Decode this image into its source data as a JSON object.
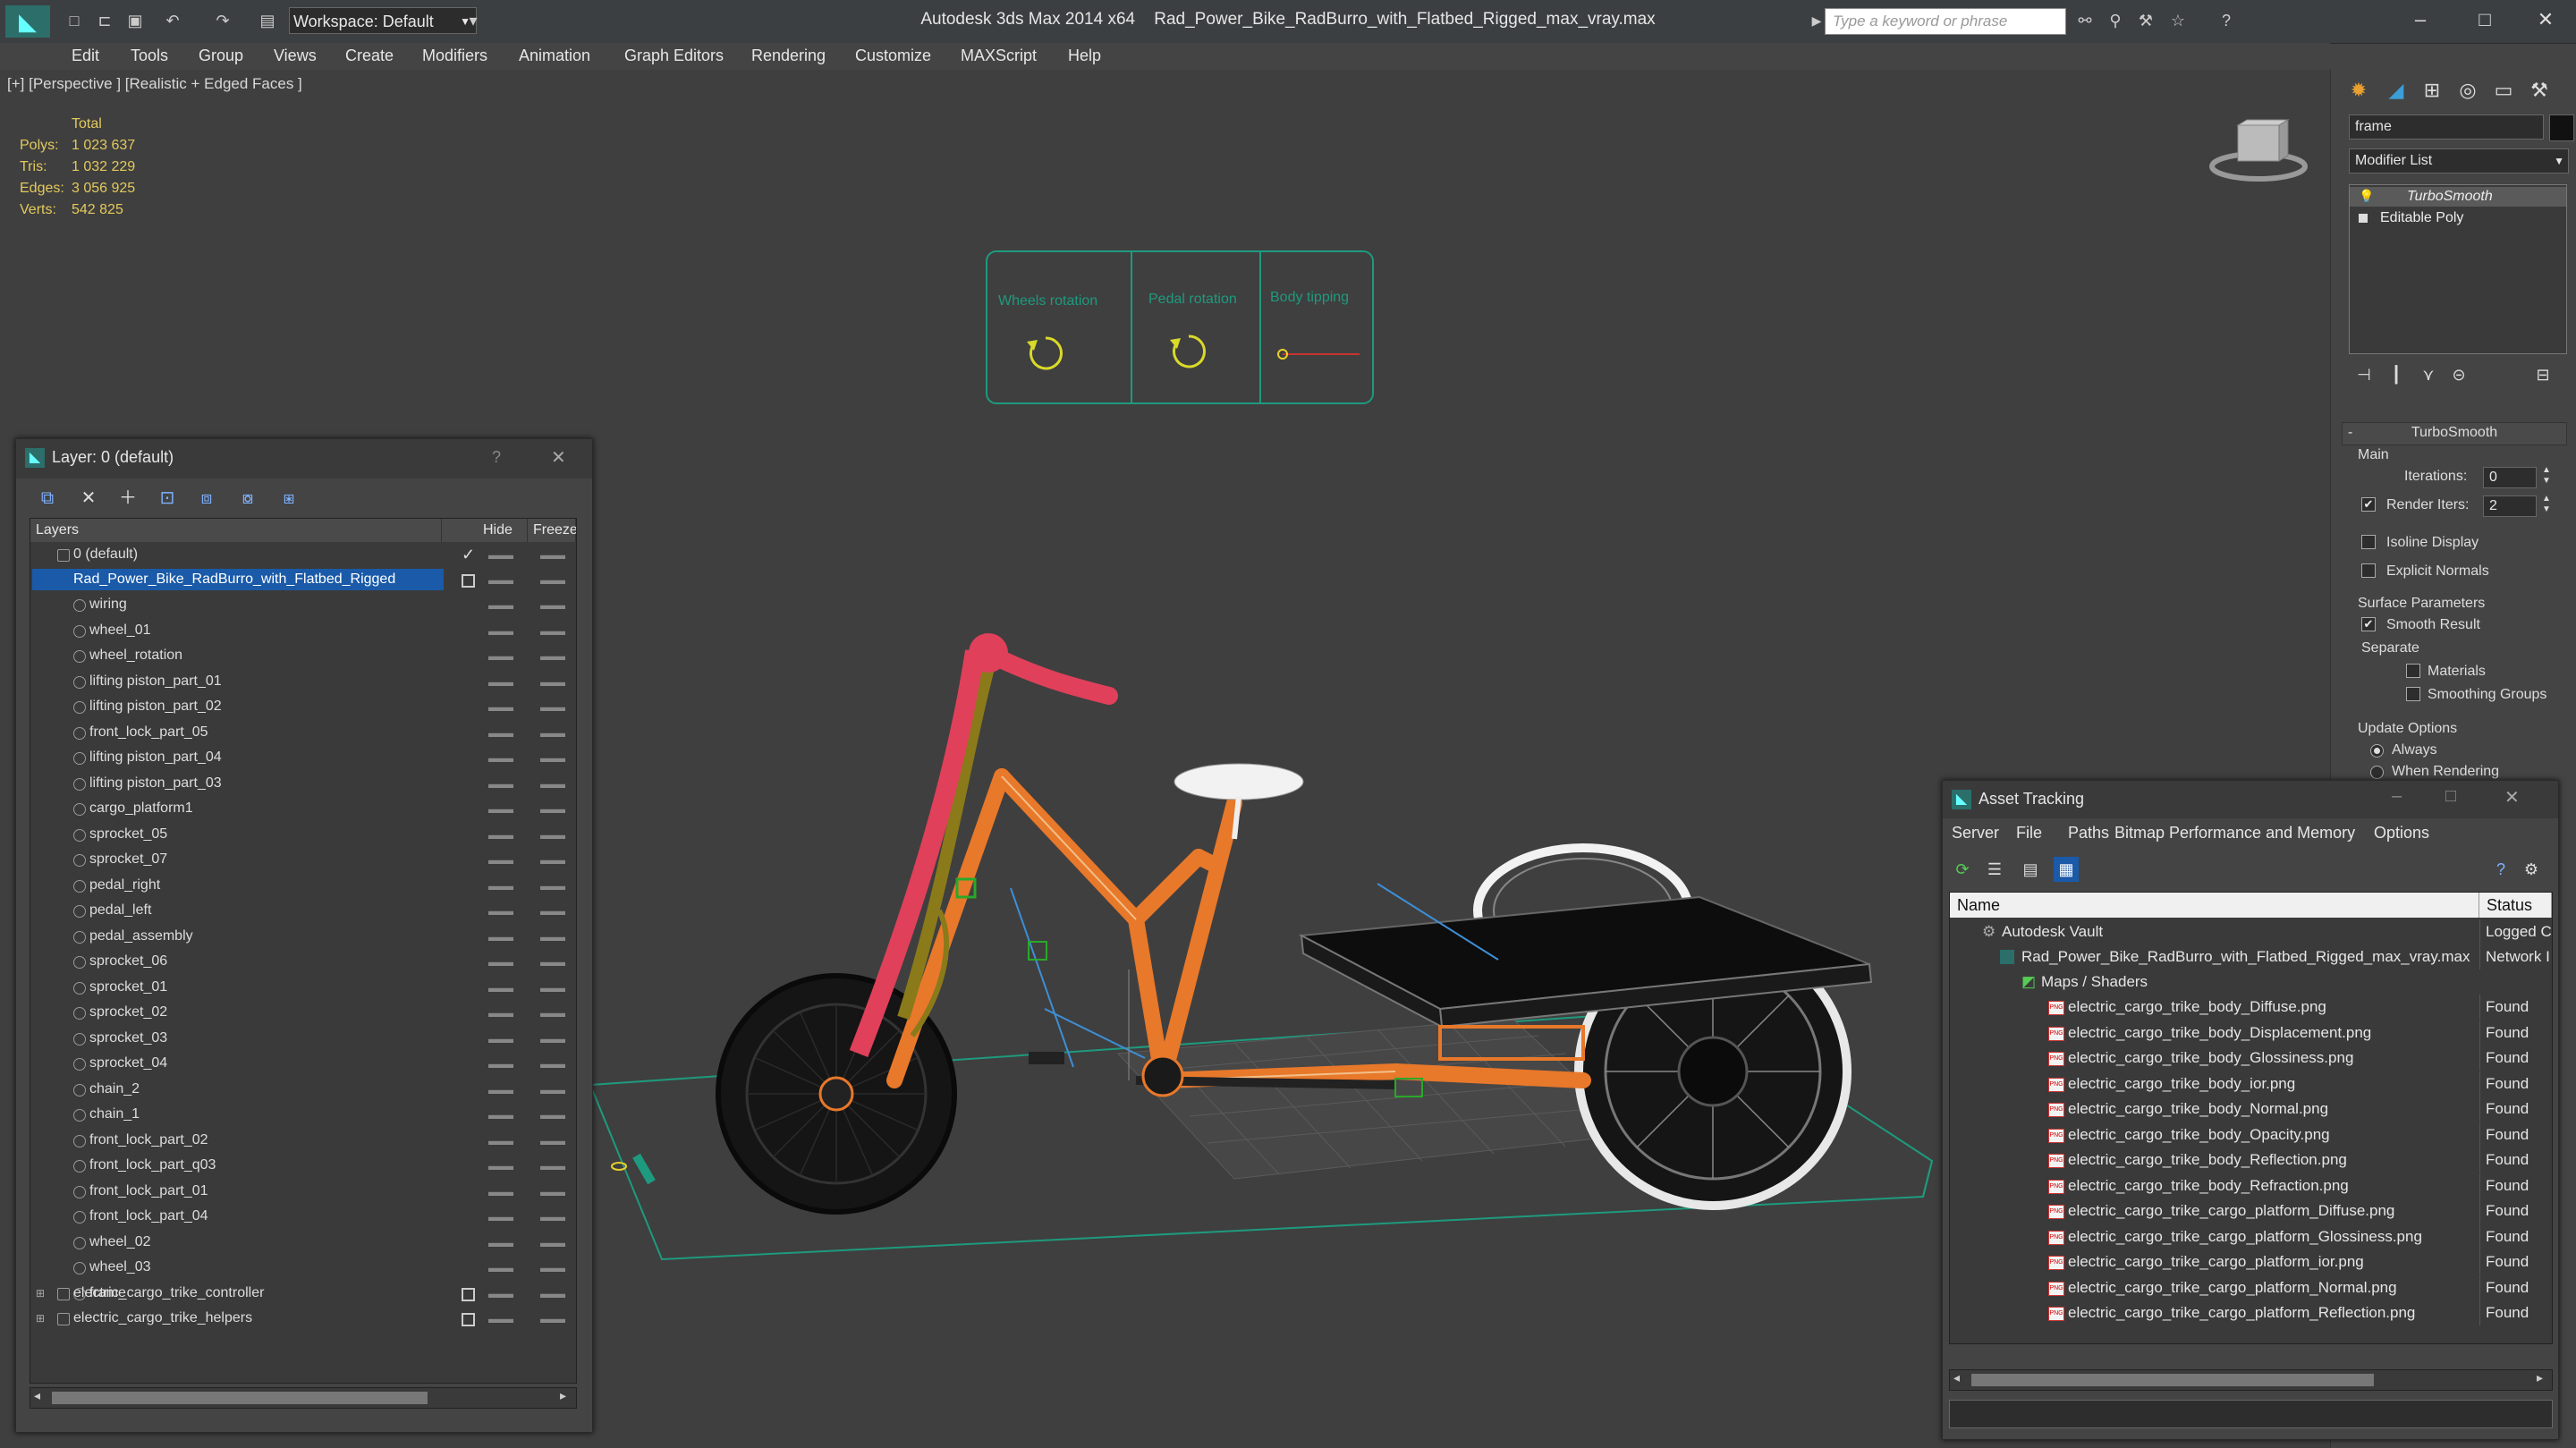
{
  "titlebar": {
    "app_title": "Autodesk 3ds Max  2014 x64",
    "file_title": "Rad_Power_Bike_RadBurro_with_Flatbed_Rigged_max_vray.max",
    "workspace_label": "Workspace: Default",
    "search_placeholder": "Type a keyword or phrase"
  },
  "menu": [
    "Edit",
    "Tools",
    "Group",
    "Views",
    "Create",
    "Modifiers",
    "Animation",
    "Graph Editors",
    "Rendering",
    "Customize",
    "MAXScript",
    "Help"
  ],
  "viewport": {
    "label": "[+] [Perspective ] [Realistic + Edged Faces ]",
    "stats": {
      "header": "Total",
      "rows": [
        {
          "label": "Polys:",
          "value": "1 023 637"
        },
        {
          "label": "Tris:",
          "value": "1 032 229"
        },
        {
          "label": "Edges:",
          "value": "3 056 925"
        },
        {
          "label": "Verts:",
          "value": "542 825"
        }
      ]
    },
    "controls": [
      {
        "label": "Wheels rotation"
      },
      {
        "label": "Pedal rotation"
      },
      {
        "label": "Body tipping"
      }
    ],
    "colors": {
      "frame": "#e8782a",
      "wire_white": "#f2f2f2",
      "handlebar": "#e0405a",
      "fork": "#8a7a1a",
      "controller": "#2aa88a",
      "cargo_top": "#0d0d0d"
    }
  },
  "command_panel": {
    "object_name": "frame",
    "modifier_list_label": "Modifier List",
    "stack": [
      {
        "name": "TurboSmooth"
      },
      {
        "name": "Editable Poly"
      }
    ],
    "rollout_title": "TurboSmooth",
    "main_group": "Main",
    "iterations_label": "Iterations:",
    "iterations_value": "0",
    "render_iters_label": "Render Iters:",
    "render_iters_value": "2",
    "isoline_label": "Isoline Display",
    "explicit_normals_label": "Explicit Normals",
    "surface_params_group": "Surface Parameters",
    "smooth_result_label": "Smooth Result",
    "separate_label": "Separate",
    "materials_label": "Materials",
    "smoothing_groups_label": "Smoothing Groups",
    "update_options_group": "Update Options",
    "always_label": "Always",
    "when_rendering_label": "When Rendering"
  },
  "layer_panel": {
    "title": "Layer: 0 (default)",
    "help": "?",
    "columns": [
      "Layers",
      "Hide",
      "Freeze"
    ],
    "default_layer": "0 (default)",
    "selected_layer": "Rad_Power_Bike_RadBurro_with_Flatbed_Rigged",
    "children": [
      "wiring",
      "wheel_01",
      "wheel_rotation",
      "lifting piston_part_01",
      "lifting piston_part_02",
      "front_lock_part_05",
      "lifting piston_part_04",
      "lifting piston_part_03",
      "cargo_platform1",
      "sprocket_05",
      "sprocket_07",
      "pedal_right",
      "pedal_left",
      "pedal_assembly",
      "sprocket_06",
      "sprocket_01",
      "sprocket_02",
      "sprocket_03",
      "sprocket_04",
      "chain_2",
      "chain_1",
      "front_lock_part_02",
      "front_lock_part_q03",
      "front_lock_part_01",
      "front_lock_part_04",
      "wheel_02",
      "wheel_03",
      "frame"
    ],
    "other_layers": [
      "electric_cargo_trike_controller",
      "electric_cargo_trike_helpers"
    ]
  },
  "asset_panel": {
    "title": "Asset Tracking",
    "menu": [
      "Server",
      "File",
      "Paths",
      "Bitmap Performance and Memory",
      "Options"
    ],
    "columns": [
      "Name",
      "Status"
    ],
    "vault": {
      "name": "Autodesk Vault",
      "status": "Logged C"
    },
    "file": {
      "name": "Rad_Power_Bike_RadBurro_with_Flatbed_Rigged_max_vray.max",
      "status": "Network I"
    },
    "group": "Maps / Shaders",
    "maps": [
      {
        "name": "electric_cargo_trike_body_Diffuse.png",
        "status": "Found"
      },
      {
        "name": "electric_cargo_trike_body_Displacement.png",
        "status": "Found"
      },
      {
        "name": "electric_cargo_trike_body_Glossiness.png",
        "status": "Found"
      },
      {
        "name": "electric_cargo_trike_body_ior.png",
        "status": "Found"
      },
      {
        "name": "electric_cargo_trike_body_Normal.png",
        "status": "Found"
      },
      {
        "name": "electric_cargo_trike_body_Opacity.png",
        "status": "Found"
      },
      {
        "name": "electric_cargo_trike_body_Reflection.png",
        "status": "Found"
      },
      {
        "name": "electric_cargo_trike_body_Refraction.png",
        "status": "Found"
      },
      {
        "name": "electric_cargo_trike_cargo_platform_Diffuse.png",
        "status": "Found"
      },
      {
        "name": "electric_cargo_trike_cargo_platform_Glossiness.png",
        "status": "Found"
      },
      {
        "name": "electric_cargo_trike_cargo_platform_ior.png",
        "status": "Found"
      },
      {
        "name": "electric_cargo_trike_cargo_platform_Normal.png",
        "status": "Found"
      },
      {
        "name": "electric_cargo_trike_cargo_platform_Reflection.png",
        "status": "Found"
      }
    ]
  }
}
